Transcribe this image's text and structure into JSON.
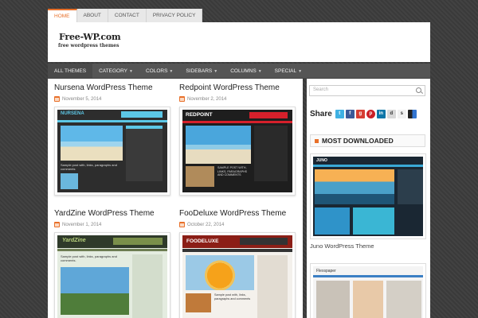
{
  "topnav": {
    "items": [
      "HOME",
      "ABOUT",
      "CONTACT",
      "PRIVACY POLICY"
    ]
  },
  "header": {
    "logo_title": "Free-WP.com",
    "logo_subtitle": "free wordpress themes"
  },
  "catnav": {
    "items": [
      "ALL THEMES",
      "CATEGORY",
      "COLORS",
      "SIDEBARS",
      "COLUMNS",
      "SPECIAL"
    ]
  },
  "posts": [
    {
      "title": "Nursena WordPress Theme",
      "date": "November 5, 2014",
      "screen_logo": "NURSENA",
      "screen_caption": "Sample post with, links, paragraphs and comments"
    },
    {
      "title": "Redpoint WordPress Theme",
      "date": "November 2, 2014",
      "screen_logo": "REDPOINT",
      "screen_caption": "SAMPLE POST WITH, LINKS, PARAGRAPHS AND COMMENTS"
    },
    {
      "title": "YardZine WordPress Theme",
      "date": "November 1, 2014",
      "screen_logo": "YardZine",
      "screen_caption": "Sample post with, links, paragraphs and comments."
    },
    {
      "title": "FooDeluxe WordPress Theme",
      "date": "October 22, 2014",
      "screen_logo": "FOODELUXE",
      "screen_caption": "Sample post with, links, paragraphs and comments"
    }
  ],
  "sidebar": {
    "search_placeholder": "Search",
    "share_label": "Share",
    "share_icons": [
      "twitter-icon",
      "facebook-icon",
      "google-plus-icon",
      "pinterest-icon",
      "linkedin-icon",
      "digg-icon",
      "stumbleupon-icon",
      "delicious-icon"
    ],
    "widget_title": "MOST DOWNLOADED",
    "downloads": [
      {
        "label": "Juno WordPress Theme",
        "screen_logo": "JUNO"
      },
      {
        "label": "",
        "screen_logo": "Flexspaper"
      }
    ]
  },
  "colors": {
    "accent": "#e8702a",
    "nav": "#555555",
    "bg": "#3d3d3d"
  }
}
